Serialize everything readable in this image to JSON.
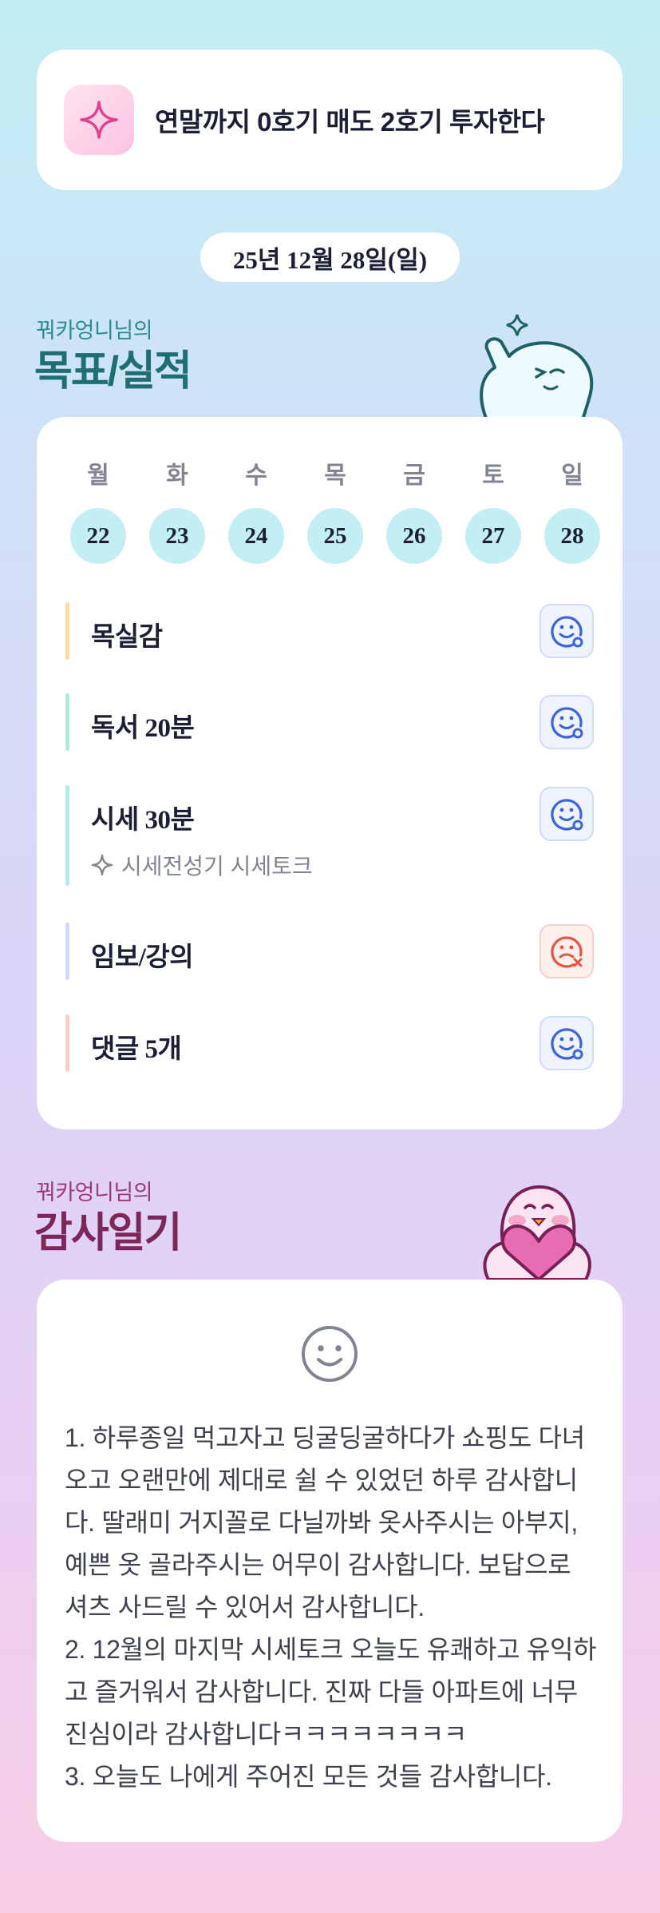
{
  "goal_banner": {
    "text": "연말까지 0호기 매도 2호기 투자한다",
    "icon": "sparkle-icon"
  },
  "date": "25년 12월 28일(일)",
  "goals_section": {
    "owner": "꿔카엉니님의",
    "heading": "목표/실적",
    "weekdays": [
      "월",
      "화",
      "수",
      "목",
      "금",
      "토",
      "일"
    ],
    "days": [
      "22",
      "23",
      "24",
      "25",
      "26",
      "27",
      "28"
    ],
    "tasks": [
      {
        "label": "목실감",
        "status": "done",
        "bar_color": "#fcdc9e"
      },
      {
        "label": "독서 20분",
        "status": "done",
        "bar_color": "#aeecd3"
      },
      {
        "label": "시세 30분",
        "status": "done",
        "bar_color": "#b3e9ee",
        "sub": "시세전성기 시세토크",
        "sub_icon": "sparkle-outline-icon"
      },
      {
        "label": "임보/강의",
        "status": "missed",
        "bar_color": "#cfdaf7"
      },
      {
        "label": "댓글 5개",
        "status": "done",
        "bar_color": "#fccbc4"
      }
    ],
    "colors": {
      "done": "#3a63e0",
      "missed": "#e8553f"
    }
  },
  "diary_section": {
    "owner": "꿔카엉니님의",
    "heading": "감사일기",
    "mood_icon": "smiley-face-icon",
    "body": "1. 하루종일 먹고자고 딩굴딩굴하다가 쇼핑도 다녀오고 오랜만에 제대로 쉴 수 있었던 하루 감사합니다. 딸래미 거지꼴로 다닐까봐 옷사주시는 아부지, 예쁜 옷 골라주시는 어무이 감사합니다. 보답으로 셔츠 사드릴 수 있어서 감사합니다.\n2. 12월의 마지막 시세토크 오늘도 유쾌하고 유익하고 즐거워서 감사합니다. 진짜 다들 아파트에 너무 진심이라 감사합니다ㅋㅋㅋㅋㅋㅋㅋㅋ\n3. 오늘도 나에게 주어진 모든 것들 감사합니다."
  }
}
